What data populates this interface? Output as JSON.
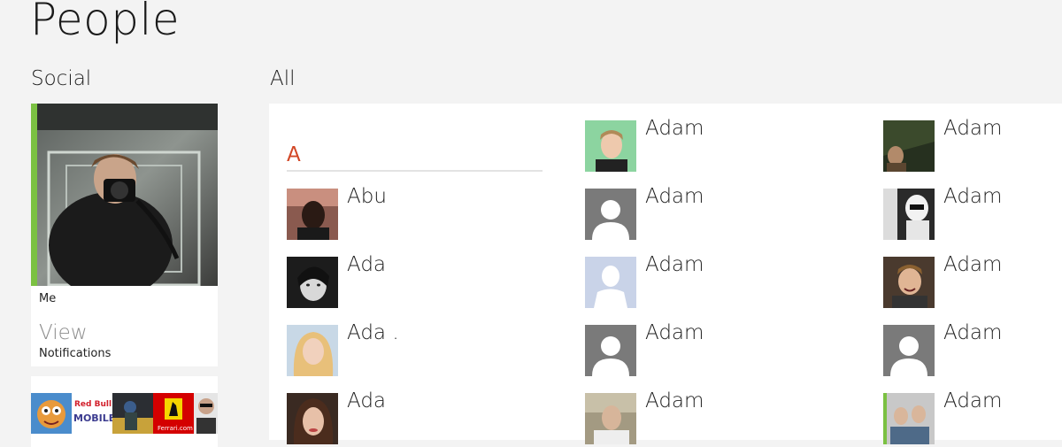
{
  "app": {
    "title": "People"
  },
  "social": {
    "heading": "Social",
    "me_label": "Me",
    "view_label": "View",
    "notifications_label": "Notifications",
    "feed_tiles": [
      {
        "name": "feed-tile-cartoon",
        "text": ""
      },
      {
        "name": "feed-tile-redbull",
        "text": "Red Bull MOBILE"
      },
      {
        "name": "feed-tile-car",
        "text": ""
      },
      {
        "name": "feed-tile-ferrari",
        "text": "Ferrari.com"
      },
      {
        "name": "feed-tile-person",
        "text": ""
      }
    ]
  },
  "all": {
    "heading": "All",
    "group_letter": "A",
    "contacts": [
      {
        "name": "Abu",
        "avatar": "photo-dark-man"
      },
      {
        "name": "Ada",
        "avatar": "photo-woman-bw"
      },
      {
        "name": "Ada .",
        "avatar": "photo-blonde"
      },
      {
        "name": "Ada",
        "avatar": "photo-brunette"
      },
      {
        "name": "Adam",
        "avatar": "photo-young-man-green"
      },
      {
        "name": "Adam",
        "avatar": "placeholder-gray"
      },
      {
        "name": "Adam",
        "avatar": "placeholder-facebook"
      },
      {
        "name": "Adam",
        "avatar": "placeholder-gray"
      },
      {
        "name": "Adam",
        "avatar": "photo-man-outdoor"
      },
      {
        "name": "Adam",
        "avatar": "photo-dark-forest"
      },
      {
        "name": "Adam",
        "avatar": "photo-stormtrooper"
      },
      {
        "name": "Adam",
        "avatar": "photo-man-laughing"
      },
      {
        "name": "Adam",
        "avatar": "placeholder-gray"
      },
      {
        "name": "Adam",
        "avatar": "photo-people-green"
      }
    ]
  },
  "colors": {
    "accent_letter": "#d24726",
    "me_stripe": "#7bc142",
    "background": "#f3f3f3",
    "facebook_placeholder": "#c9d3e8"
  }
}
